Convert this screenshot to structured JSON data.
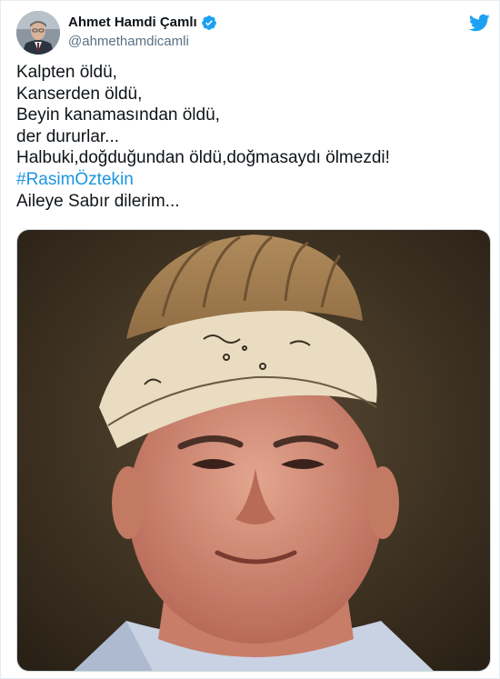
{
  "author": {
    "display_name": "Ahmet Hamdi Çamlı",
    "handle": "@ahmethamdicamli",
    "verified": true
  },
  "tweet": {
    "lines": [
      "Kalpten öldü,",
      "Kanserden öldü,",
      "Beyin kanamasından öldü,",
      "der dururlar...",
      "Halbuki,doğduğundan öldü,doğmasaydı ölmezdi!"
    ],
    "hashtag": "#RasimÖztekin",
    "closing": "Aileye Sabır dilerim..."
  },
  "colors": {
    "brand": "#1da1f2",
    "hashtag": "#1b95e0",
    "handle": "#5b7083",
    "text": "#0f1419"
  },
  "icons": {
    "logo": "twitter-bird-icon",
    "verified": "verified-badge-icon"
  }
}
